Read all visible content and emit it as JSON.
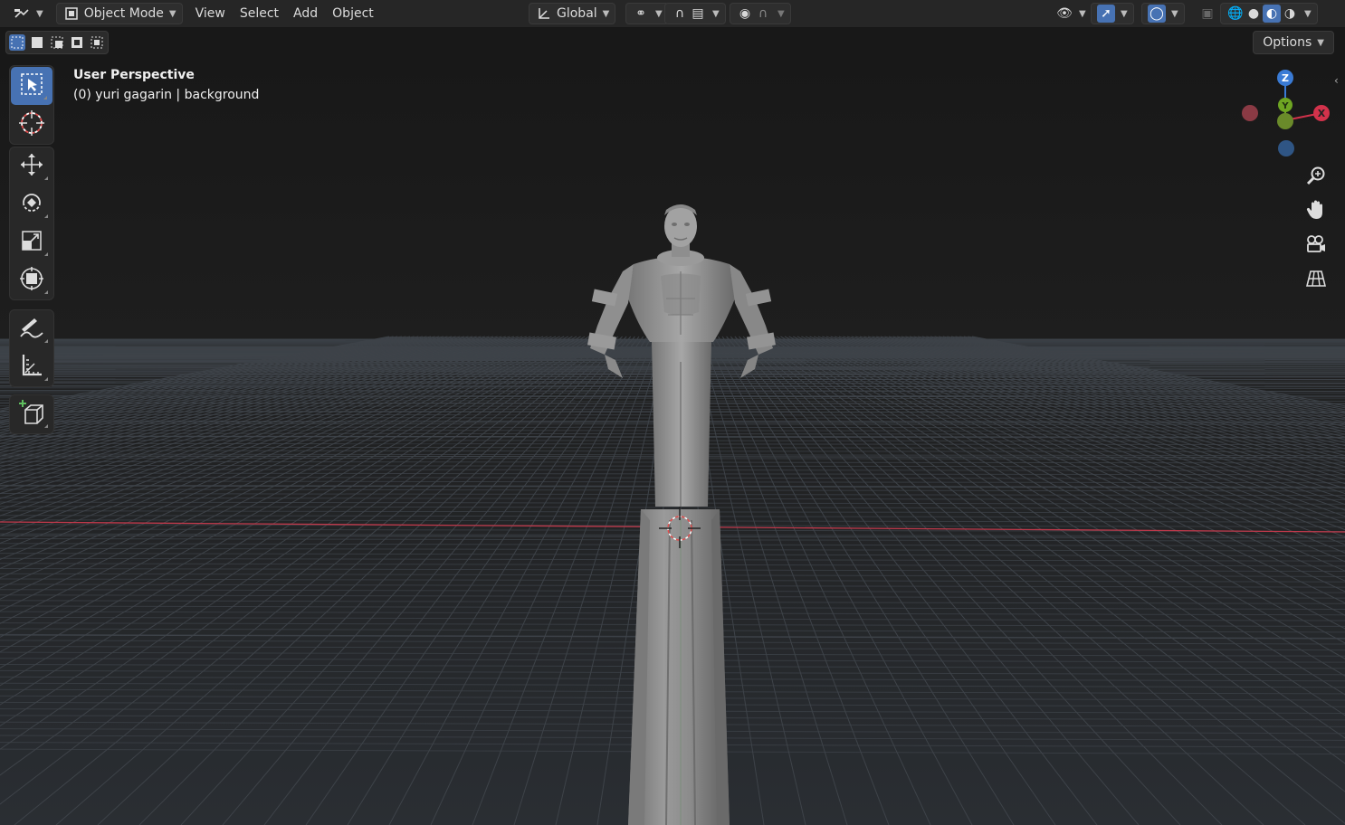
{
  "header": {
    "editor_type_icon": "editor-type-icon",
    "mode_label": "Object Mode",
    "menus": [
      "View",
      "Select",
      "Add",
      "Object"
    ],
    "transform_orientation": "Global",
    "options_label": "Options"
  },
  "viewport": {
    "view_name": "User Perspective",
    "object_info": "(0) yuri gagarin | background"
  },
  "gizmo": {
    "z_label": "Z",
    "y_label": "Y",
    "x_label": "X"
  },
  "colors": {
    "accent": "#4772b3",
    "axis_x": "#d2324b",
    "axis_y": "#6ea522",
    "axis_z": "#3a7bd5"
  },
  "toolbar": {
    "tools": [
      "select-box-icon",
      "cursor-icon",
      "move-icon",
      "rotate-icon",
      "scale-icon",
      "transform-icon",
      "annotate-icon",
      "measure-icon",
      "add-cube-icon"
    ]
  }
}
